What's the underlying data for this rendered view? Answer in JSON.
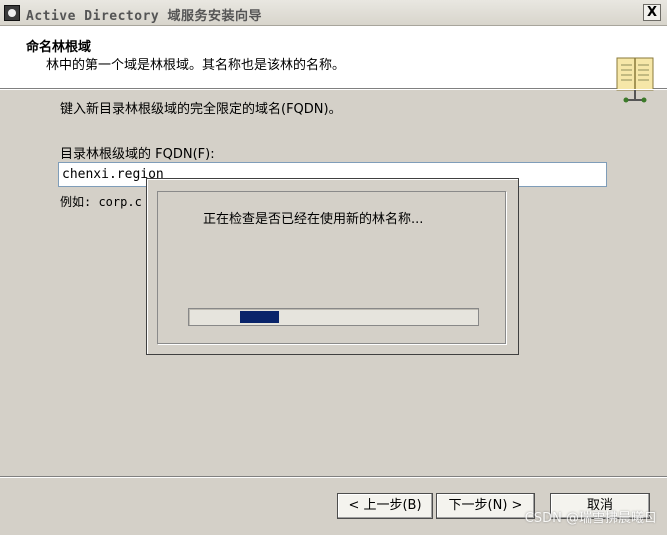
{
  "window": {
    "title": "Active Directory 域服务安装向导",
    "close_label": "X"
  },
  "header": {
    "title": "命名林根域",
    "subtitle": "林中的第一个域是林根域。其名称也是该林的名称。"
  },
  "main": {
    "prompt": "键入新目录林根级域的完全限定的域名(FQDN)。",
    "fqdn_label": "目录林根级域的 FQDN(F):",
    "fqdn_value": "chenxi.region",
    "example": "例如: corp.c"
  },
  "buttons": {
    "back": "< 上一步(B)",
    "next": "下一步(N) >",
    "cancel": "取消"
  },
  "dialog": {
    "message": "正在检查是否已经在使用新的林名称...",
    "progress_start": 0.175,
    "progress_end": 0.31
  },
  "watermark": "CSDN @瑞雪拂晨曦ㄖ",
  "colors": {
    "progress_fill": "#0a246a",
    "dialog_bg": "#d4d0c8"
  }
}
